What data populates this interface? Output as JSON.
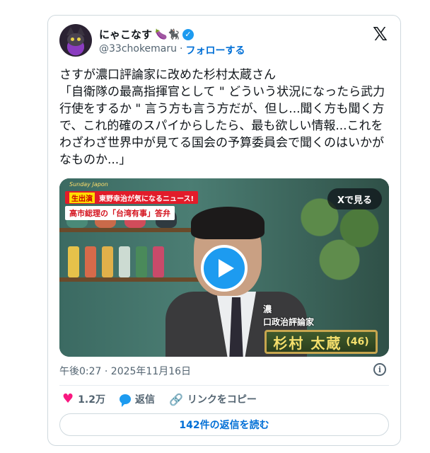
{
  "author": {
    "display_name": "にゃこなす",
    "name_emojis": "🍆🐈‍⬛",
    "handle": "@33chokemaru",
    "separator": "·",
    "follow_label": "フォローする"
  },
  "tweet": {
    "text": "さすが濃口評論家に改めた杉村太蔵さん\n「自衛隊の最高指揮官として \" どういう状況になったら武力行使をするか \" 言う方も言う方だが、但し...聞く方も聞く方で、これ的確のスパイからしたら、最も欲しい情報...これをわざわざ世界中が見てる国会の予算委員会で聞くのはいかがなものか...」"
  },
  "video": {
    "program_tag": "Sunday Japon",
    "live_label": "生出演",
    "headline": "東野幸治が気になるニュース!",
    "subheadline": "高市総理の「台湾有事」答弁",
    "watch_on_x": "Xで見る",
    "caption_top": "濃",
    "caption_role": "口政治評論家",
    "caption_name": "杉村 太蔵",
    "caption_age": "(46)"
  },
  "footer": {
    "timestamp": "午後0:27 · 2025年11月16日",
    "likes": "1.2万",
    "reply_label": "返信",
    "copy_link_label": "リンクをコピー",
    "read_replies": "142件の返信を読む"
  },
  "colors": {
    "accent": "#1d9bf0",
    "link": "#006fd6",
    "like": "#f91880",
    "muted": "#536471"
  }
}
